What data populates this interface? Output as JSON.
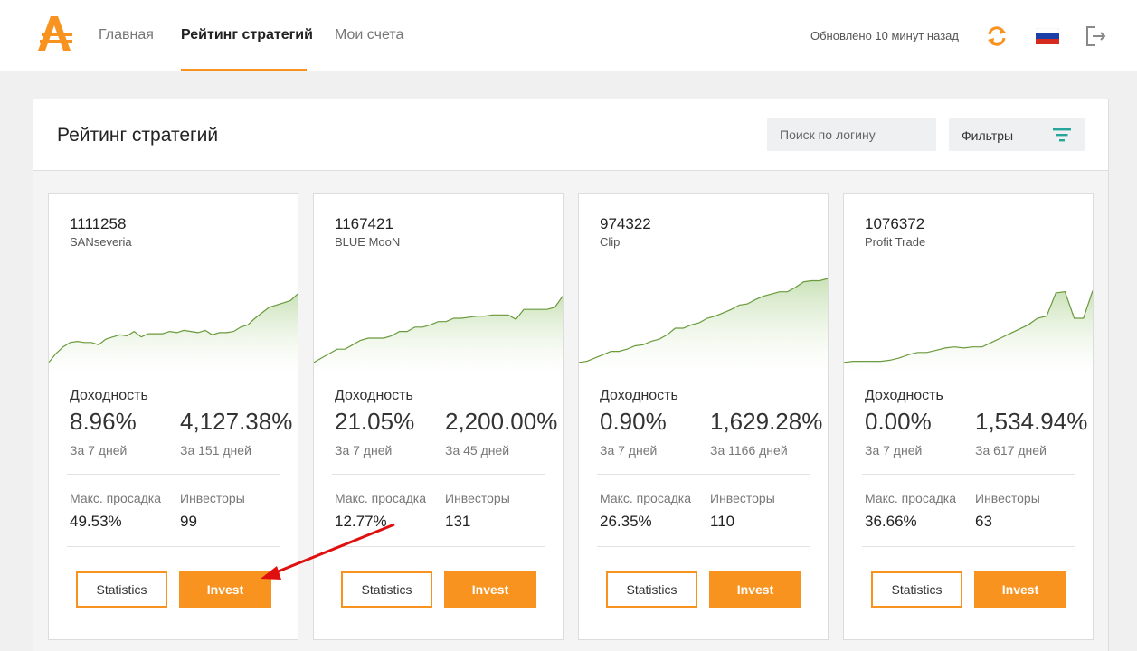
{
  "nav": {
    "items": [
      {
        "label": "Главная",
        "active": false
      },
      {
        "label": "Рейтинг стратегий",
        "active": true
      },
      {
        "label": "Мои счета",
        "active": false
      }
    ],
    "updated_text": "Обновлено 10 минут назад",
    "icons": [
      "logo",
      "refresh-icon",
      "flag-ru-icon",
      "logout-icon"
    ],
    "accent_color": "#f7931e"
  },
  "panel": {
    "title": "Рейтинг стратегий",
    "search_placeholder": "Поиск по логину",
    "filter_label": "Фильтры"
  },
  "labels": {
    "yield": "Доходность",
    "drawdown": "Макс. просадка",
    "investors": "Инвесторы",
    "statistics_button": "Statistics",
    "invest_button": "Invest"
  },
  "cards": [
    {
      "account": "1111258",
      "name": "SANseveria",
      "yield_7d": "8.96%",
      "yield_total": "4,127.38%",
      "period_7d": "За 7 дней",
      "period_total": "За 151 дней",
      "drawdown": "49.53%",
      "investors": "99",
      "equity": [
        10,
        18,
        24,
        28,
        29,
        28,
        28,
        26,
        31,
        33,
        35,
        34,
        38,
        33,
        36,
        36,
        36,
        38,
        37,
        39,
        38,
        37,
        39,
        35,
        37,
        37,
        38,
        42,
        44,
        50,
        55,
        60,
        62,
        64,
        66,
        72
      ]
    },
    {
      "account": "1167421",
      "name": "BLUE MooN",
      "yield_7d": "21.05%",
      "yield_total": "2,200.00%",
      "period_7d": "За 7 дней",
      "period_total": "За 45 дней",
      "drawdown": "12.77%",
      "investors": "131",
      "equity": [
        10,
        14,
        18,
        22,
        22,
        26,
        30,
        32,
        32,
        32,
        34,
        38,
        38,
        42,
        42,
        44,
        47,
        47,
        50,
        50,
        51,
        52,
        52,
        53,
        53,
        53,
        49,
        58,
        58,
        58,
        58,
        60,
        70
      ]
    },
    {
      "account": "974322",
      "name": "Clip",
      "yield_7d": "0.90%",
      "yield_total": "1,629.28%",
      "period_7d": "За 7 дней",
      "period_total": "За 1166 дней",
      "drawdown": "26.35%",
      "investors": "110",
      "equity": [
        10,
        11,
        14,
        17,
        20,
        20,
        22,
        25,
        26,
        29,
        31,
        35,
        41,
        41,
        44,
        46,
        50,
        52,
        55,
        58,
        62,
        63,
        67,
        70,
        72,
        74,
        74,
        78,
        83,
        84,
        84,
        86
      ]
    },
    {
      "account": "1076372",
      "name": "Profit Trade",
      "yield_7d": "0.00%",
      "yield_total": "1,534.94%",
      "period_7d": "За 7 дней",
      "period_total": "За 617 дней",
      "drawdown": "36.66%",
      "investors": "63",
      "equity": [
        10,
        11,
        11,
        11,
        11,
        12,
        14,
        17,
        19,
        19,
        21,
        23,
        24,
        23,
        24,
        24,
        28,
        32,
        36,
        40,
        44,
        50,
        52,
        73,
        74,
        50,
        50,
        75
      ]
    }
  ]
}
